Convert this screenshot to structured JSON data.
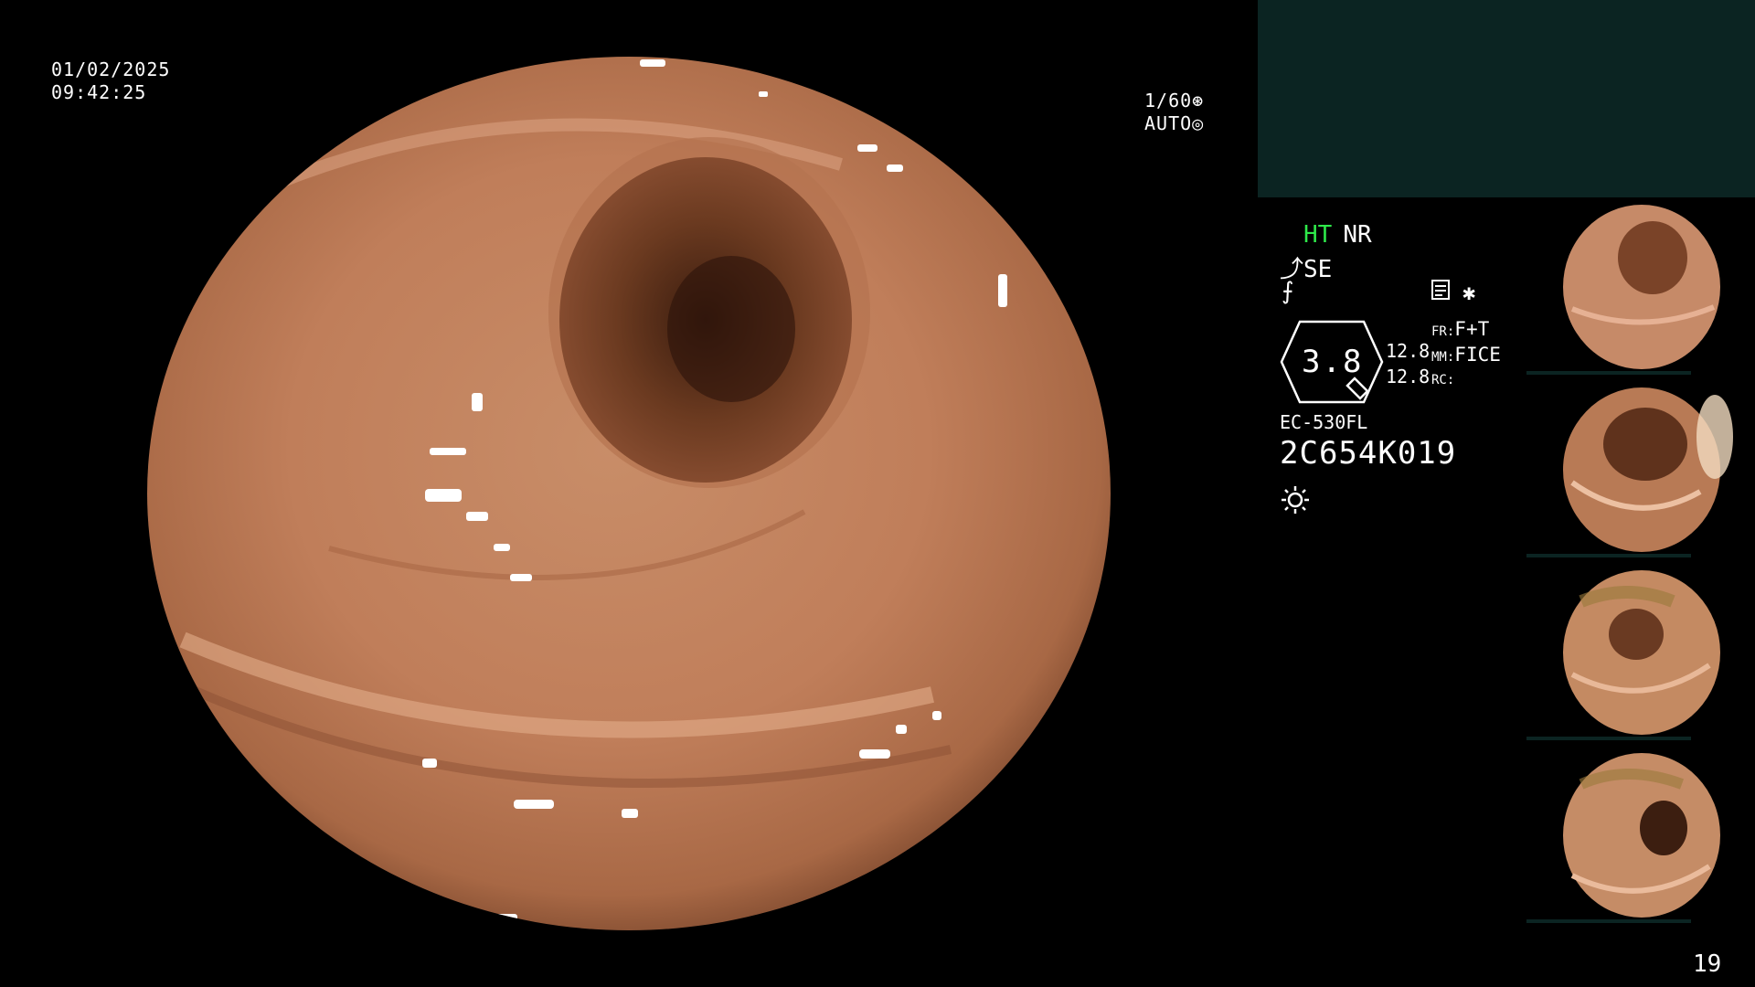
{
  "osd": {
    "date": "01/02/2025",
    "time": "09:42:25",
    "shutter": "1/60",
    "iris": "AUTO"
  },
  "status": {
    "ht": "HT",
    "nr": "NR",
    "se": "SE",
    "zoom": "3.8",
    "values": [
      "12.8",
      "12.8"
    ],
    "fr_label": "FR:",
    "fr_value": "F+T",
    "mm_label": "MM:",
    "mm_value": "FICE",
    "rc_label": "RC:"
  },
  "scope": {
    "model": "EC-530FL",
    "serial": "2C654K019"
  },
  "thumbnails": [
    {
      "name": "capture-1"
    },
    {
      "name": "capture-2"
    },
    {
      "name": "capture-3"
    },
    {
      "name": "capture-4"
    }
  ],
  "page_number": "19",
  "colors": {
    "background": "#000000",
    "panel": "#0b2422",
    "ht_green": "#2ee84a",
    "mucosa": "#c98963"
  }
}
